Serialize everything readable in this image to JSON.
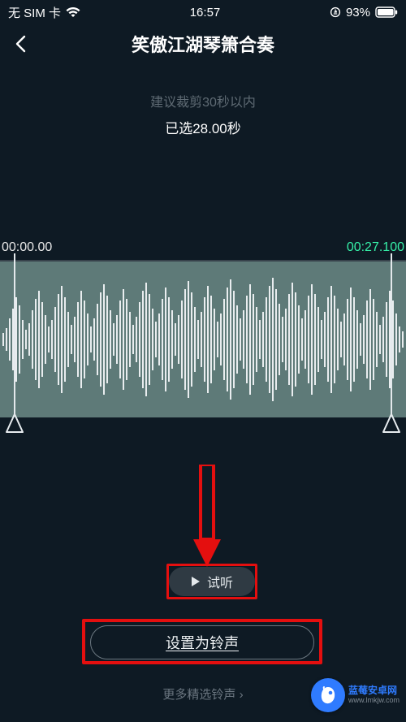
{
  "status": {
    "sim": "无 SIM 卡",
    "time": "16:57",
    "battery_pct": "93%"
  },
  "nav": {
    "title": "笑傲江湖琴箫合奏"
  },
  "hint": {
    "trim": "建议裁剪30秒以内",
    "selected": "已选28.00秒"
  },
  "wave": {
    "start_tc": "00:00.00",
    "end_tc": "00:27.100"
  },
  "actions": {
    "preview": "试听",
    "set_ringtone": "设置为铃声",
    "more": "更多精选铃声"
  },
  "watermark": {
    "brand": "蓝莓安卓网",
    "url": "www.lmkjw.com"
  }
}
